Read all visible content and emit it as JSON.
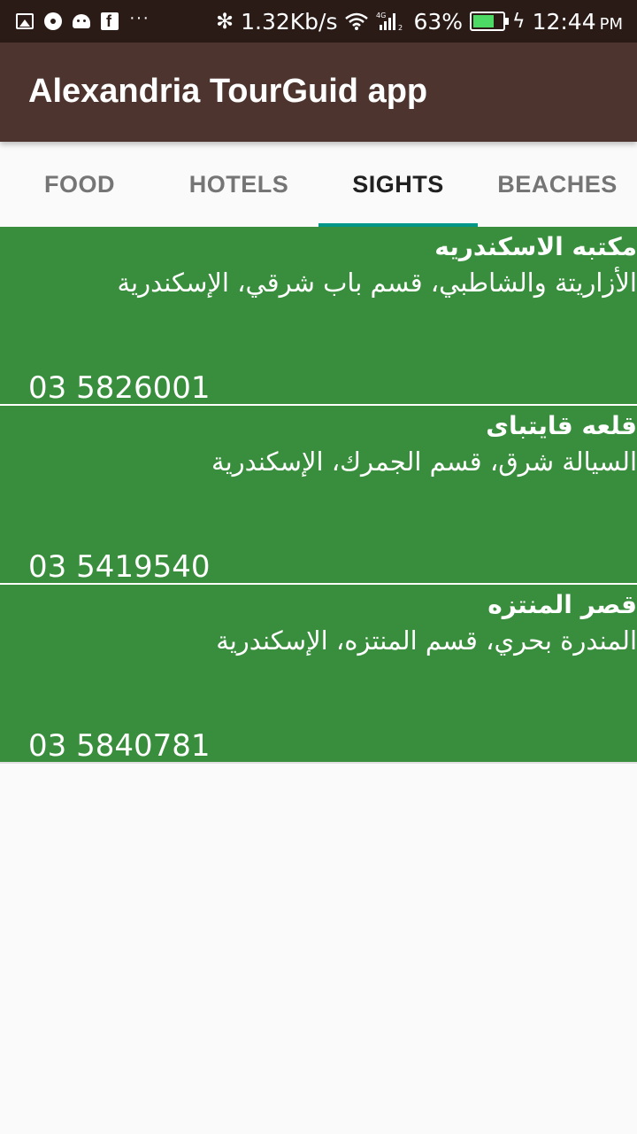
{
  "status_bar": {
    "left_icons": [
      "image-icon",
      "disc-icon",
      "android-icon",
      "facebook-icon",
      "more-notifications-icon"
    ],
    "more_glyph": "···",
    "bluetooth_glyph": "✻",
    "network_speed": "1.32Kb/s",
    "network_type": "4G",
    "battery_percent": "63%",
    "battery_level": 0.63,
    "bolt_glyph": "ϟ",
    "time": "12:44",
    "ampm": "PM"
  },
  "app_bar": {
    "title": "Alexandria TourGuid app",
    "color": "#4e342e"
  },
  "tabs": [
    {
      "label": "FOOD",
      "active": false
    },
    {
      "label": "HOTELS",
      "active": false
    },
    {
      "label": "SIGHTS",
      "active": true
    },
    {
      "label": "BEACHES",
      "active": false
    }
  ],
  "accent_color": "#009688",
  "list_item_color": "#388e3c",
  "items": [
    {
      "name": "مكتبه الاسكندريه",
      "address": "الأزاريتة والشاطبي، قسم باب شرقي، الإسكندرية",
      "phone": "03 5826001"
    },
    {
      "name": "قلعه قايتباى",
      "address": "السيالة شرق، قسم الجمرك، الإسكندرية",
      "phone": "03 5419540"
    },
    {
      "name": "قصر المنتزه",
      "address": "المندرة بحري، قسم المنتزه، الإسكندرية",
      "phone": "03 5840781"
    }
  ]
}
